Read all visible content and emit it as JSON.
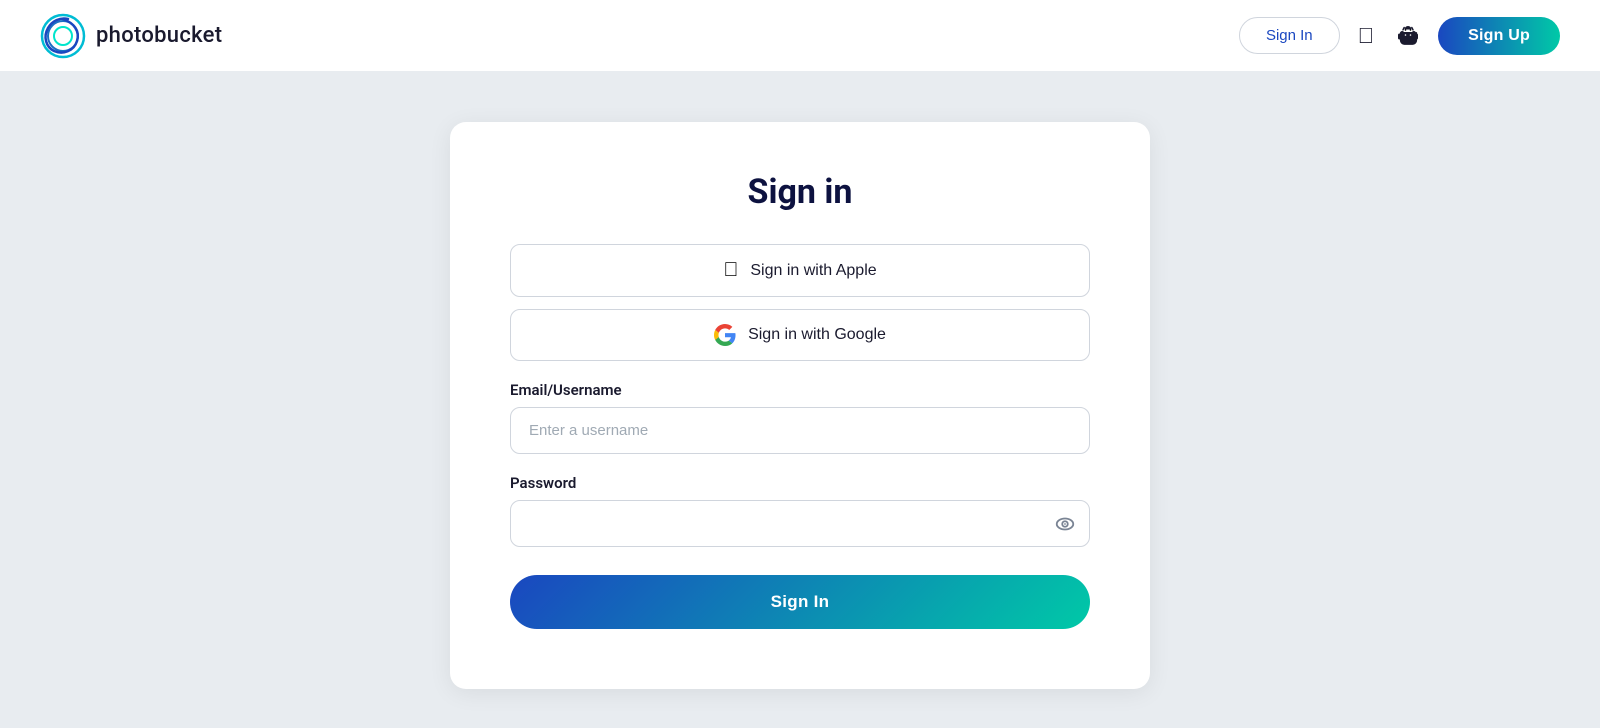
{
  "header": {
    "logo_text": "photobucket",
    "sign_in_label": "Sign In",
    "apple_icon_label": "",
    "android_icon_label": "",
    "sign_up_label": "Sign Up"
  },
  "signin_card": {
    "title": "Sign in",
    "apple_btn_label": "Sign in with Apple",
    "google_btn_label": "Sign in with Google",
    "email_label": "Email/Username",
    "email_placeholder": "Enter a username",
    "password_label": "Password",
    "password_placeholder": "",
    "submit_label": "Sign In"
  },
  "colors": {
    "brand_gradient_start": "#1a47c0",
    "brand_gradient_end": "#00c9a7",
    "background": "#e8ecf0",
    "card_bg": "#ffffff",
    "title_color": "#0d1240"
  }
}
